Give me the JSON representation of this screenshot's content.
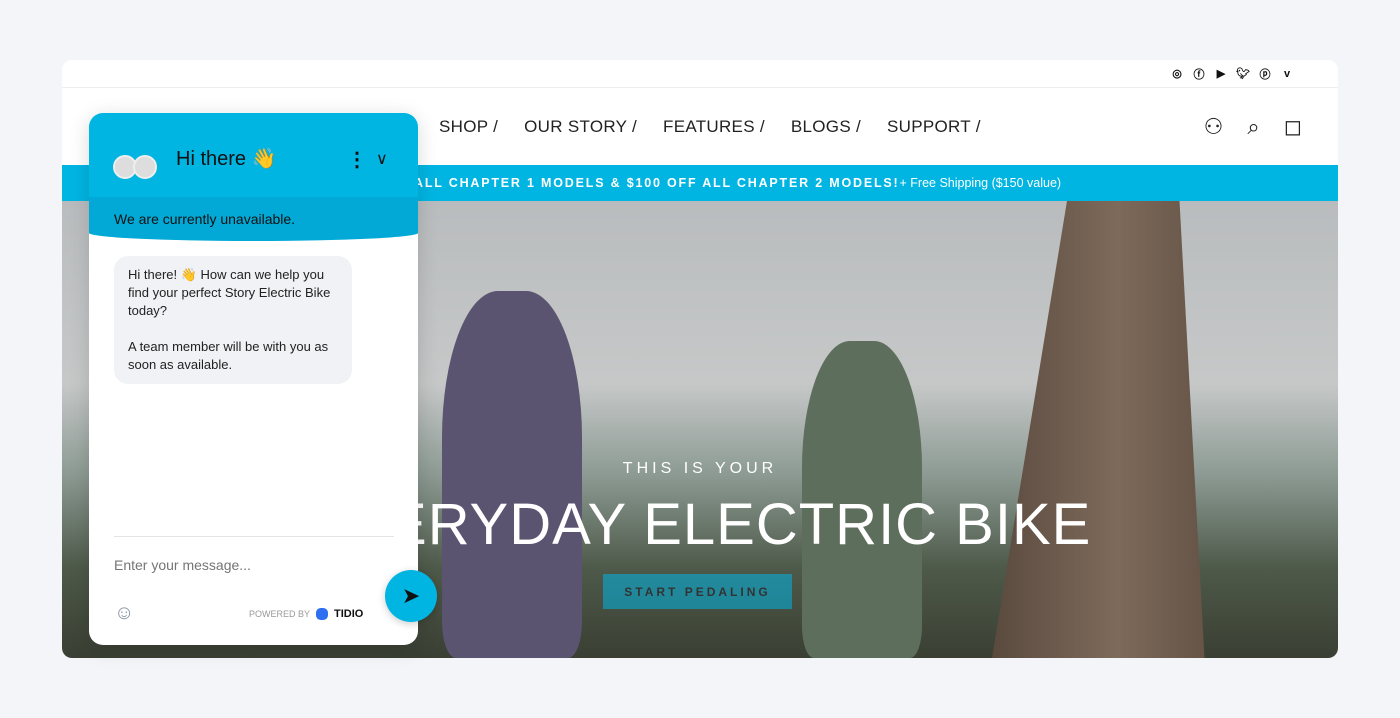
{
  "social": [
    "instagram-icon",
    "facebook-icon",
    "youtube-icon",
    "twitter-icon",
    "pinterest-icon",
    "vimeo-icon"
  ],
  "nav": {
    "items": [
      "SHOP /",
      "OUR STORY /",
      "FEATURES /",
      "BLOGS /",
      "SUPPORT /"
    ]
  },
  "banner": {
    "bold": "ALL CHAPTER 1 MODELS & $100 OFF ALL CHAPTER 2 MODELS!",
    "rest": " + Free Shipping ($150 value)"
  },
  "hero": {
    "subtitle": "THIS IS YOUR",
    "title": "EVERYDAY ELECTRIC BIKE",
    "button": "START PEDALING"
  },
  "chat": {
    "title": "Hi there 👋",
    "status": "We are currently unavailable.",
    "message1": "Hi there! 👋 How can we help you find your perfect Story Electric Bike today?",
    "message2": "A team member will be with you as soon as available.",
    "placeholder": "Enter your message...",
    "powered_by": "POWERED BY",
    "brand": "TIDIO"
  },
  "colors": {
    "accent": "#00b5e2"
  }
}
